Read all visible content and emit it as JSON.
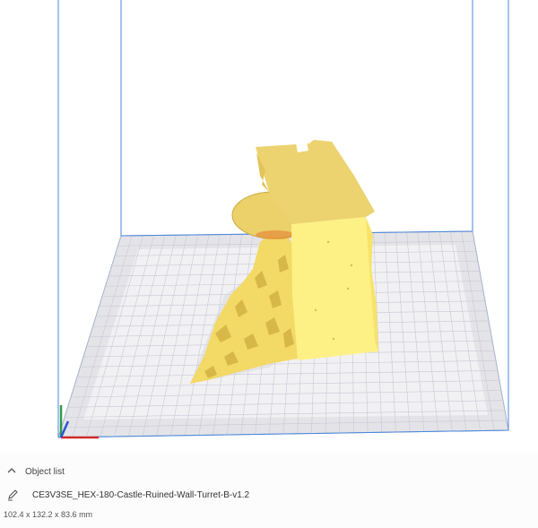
{
  "panel": {
    "object_list_label": "Object list",
    "object_name": "CE3V3SE_HEX-180-Castle-Ruined-Wall-Turret-B-v1.2",
    "dimensions": "102.4 x 132.2 x 83.6 mm"
  },
  "icons": {
    "toggle": "chevron-up-icon",
    "edit": "pencil-icon"
  },
  "colors": {
    "model": "#f7e36b",
    "model_shadow": "#d9b845",
    "plate_light": "#f1f1f3",
    "plate_dark": "#e2e2e6",
    "grid_line": "#c8c8d8",
    "build_volume_line": "#3f7fd6",
    "axis_x": "#d22a2a",
    "axis_y": "#2c9b48",
    "axis_z": "#2b55d6"
  }
}
